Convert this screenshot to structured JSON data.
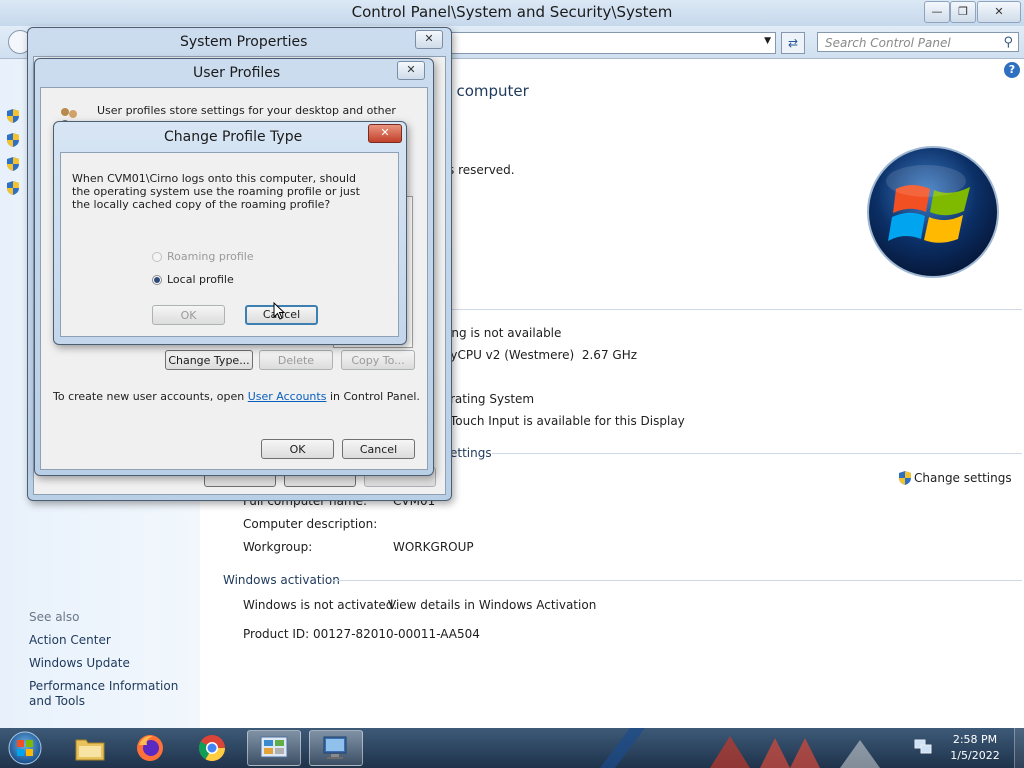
{
  "main_window": {
    "title": "Control Panel\\System and Security\\System",
    "search_placeholder": "Search Control Panel",
    "heading_partial": "ur computer",
    "rights_partial": "s reserved.",
    "rating_partial": "ing is not available",
    "processor_partial": "ayCPU v2 (Westmere)",
    "processor_speed": "2.67 GHz",
    "os_type_partial": "rating System",
    "pen_partial": "Touch Input is available for this Display",
    "settings_header_partial": "ettings",
    "change_settings": "Change settings",
    "full_name_label": "Full computer name:",
    "full_name_value": "CVM01",
    "description_label": "Computer description:",
    "workgroup_label": "Workgroup:",
    "workgroup_value": "WORKGROUP",
    "activation_header": "Windows activation",
    "activation_status": "Windows is not activated.",
    "activation_link": "View details in Windows Activation",
    "product_id": "Product ID: 00127-82010-00011-AA504"
  },
  "sidebar": {
    "see_also": "See also",
    "links": [
      "Action Center",
      "Windows Update",
      "Performance Information and Tools"
    ]
  },
  "system_properties": {
    "title": "System Properties"
  },
  "user_profiles": {
    "title": "User Profiles",
    "intro_line1": "User profiles store settings for your desktop and other",
    "change_type_button": "Change Type...",
    "delete_button": "Delete",
    "copy_to_button": "Copy To...",
    "create_text_before": "To create new user accounts, open",
    "create_link": "User Accounts",
    "create_text_after": "in Control Panel.",
    "ok_button": "OK",
    "cancel_button": "Cancel"
  },
  "change_profile_type": {
    "title": "Change Profile Type",
    "question": "When CVM01\\Cirno logs onto this computer, should the operating system use the roaming profile or just the locally cached copy of the roaming profile?",
    "roaming_label": "Roaming profile",
    "local_label": "Local profile",
    "selected": "Local profile",
    "ok_button": "OK",
    "cancel_button": "Cancel"
  },
  "taskbar": {
    "time": "2:58 PM",
    "date": "1/5/2022",
    "apps": [
      "start-orb",
      "file-explorer",
      "firefox",
      "chrome",
      "control-panel",
      "system-properties"
    ]
  },
  "colors": {
    "link": "#0a5fbe",
    "taskbar": "#2a4460",
    "dialog_frame": "#c6d8ec"
  }
}
